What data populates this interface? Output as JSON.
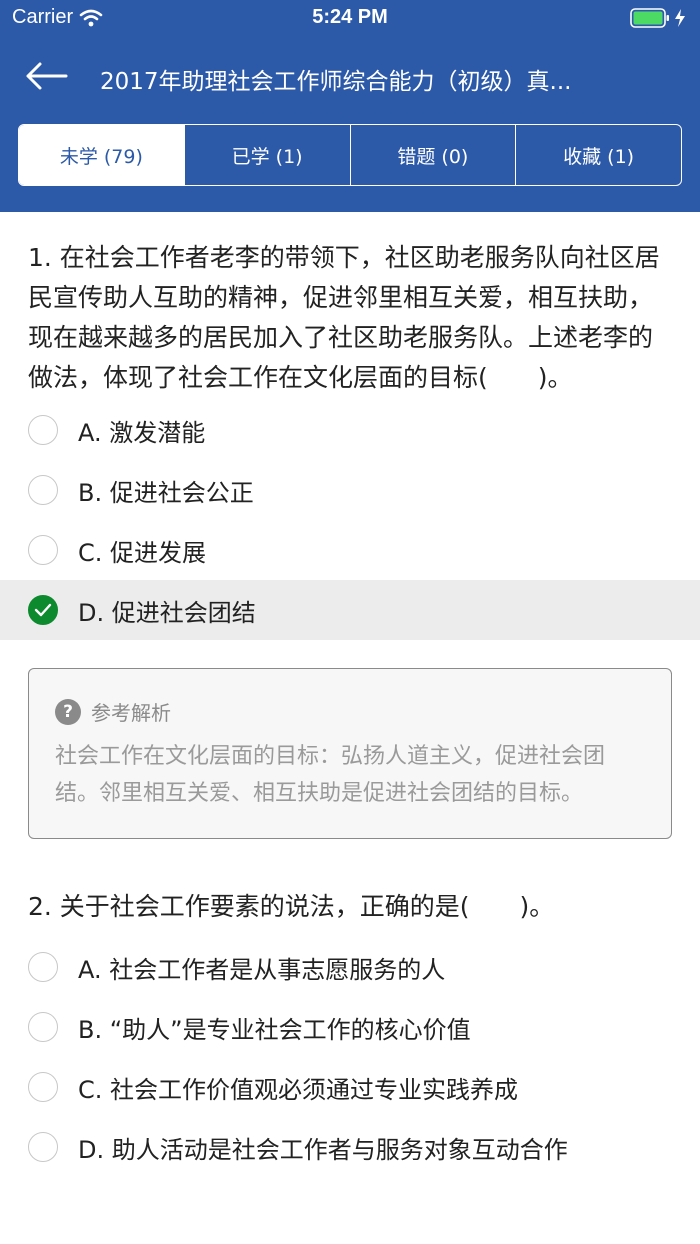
{
  "status": {
    "carrier": "Carrier",
    "time": "5:24 PM"
  },
  "nav": {
    "title": "2017年助理社会工作师综合能力（初级）真..."
  },
  "tabs": [
    {
      "label": "未学 (79)"
    },
    {
      "label": "已学 (1)"
    },
    {
      "label": "错题 (0)"
    },
    {
      "label": "收藏 (1)"
    }
  ],
  "questions": [
    {
      "text": "1. 在社会工作者老李的带领下，社区助老服务队向社区居民宣传助人互助的精神，促进邻里相互关爱，相互扶助，现在越来越多的居民加入了社区助老服务队。上述老李的做法，体现了社会工作在文化层面的目标(　　)。",
      "options": [
        {
          "label": "A. 激发潜能"
        },
        {
          "label": "B. 促进社会公正"
        },
        {
          "label": "C. 促进发展"
        },
        {
          "label": "D. 促进社会团结"
        }
      ],
      "analysis": {
        "title": "参考解析",
        "text": "社会工作在文化层面的目标：弘扬人道主义，促进社会团结。邻里相互关爱、相互扶助是促进社会团结的目标。"
      }
    },
    {
      "text": "2. 关于社会工作要素的说法，正确的是(　　)。",
      "options": [
        {
          "label": "A. 社会工作者是从事志愿服务的人"
        },
        {
          "label": "B. “助人”是专业社会工作的核心价值"
        },
        {
          "label": "C. 社会工作价值观必须通过专业实践养成"
        },
        {
          "label": "D. 助人活动是社会工作者与服务对象互动合作"
        }
      ]
    }
  ],
  "colors": {
    "header": "#2c5aa8",
    "correct": "#0e8a2e"
  }
}
